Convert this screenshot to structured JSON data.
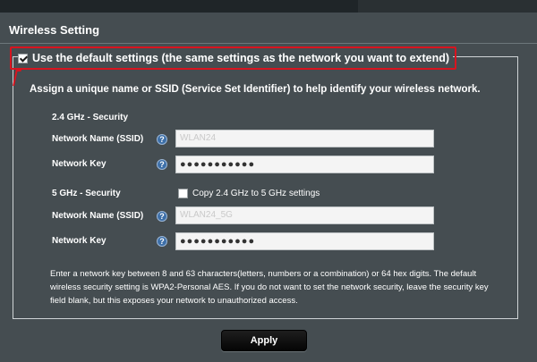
{
  "panel": {
    "title": "Wireless Setting"
  },
  "default_settings": {
    "checked": true,
    "label": "Use the default settings (the same settings as the network you want to extend)"
  },
  "assign_text": "Assign a unique name or SSID (Service Set Identifier) to help identify your wireless network.",
  "band_24": {
    "section_title": "2.4 GHz - Security",
    "ssid_label": "Network Name (SSID)",
    "ssid_value": "WLAN24",
    "key_label": "Network Key",
    "key_value": "●●●●●●●●●●●"
  },
  "band_5": {
    "section_title": "5 GHz - Security",
    "copy_label": "Copy 2.4 GHz to 5 GHz settings",
    "copy_checked": false,
    "ssid_label": "Network Name (SSID)",
    "ssid_value": "WLAN24_5G",
    "key_label": "Network Key",
    "key_value": "●●●●●●●●●●●"
  },
  "help_glyph": "?",
  "note": "Enter a network key between 8 and 63 characters(letters, numbers or a combination) or 64 hex digits. The default wireless security setting is WPA2-Personal AES. If you do not want to set the network security, leave the security key field blank, but this exposes your network to unauthorized access.",
  "apply_label": "Apply",
  "colors": {
    "background": "#454d51",
    "highlight": "#d8141f",
    "button": "#0a0a0a"
  }
}
